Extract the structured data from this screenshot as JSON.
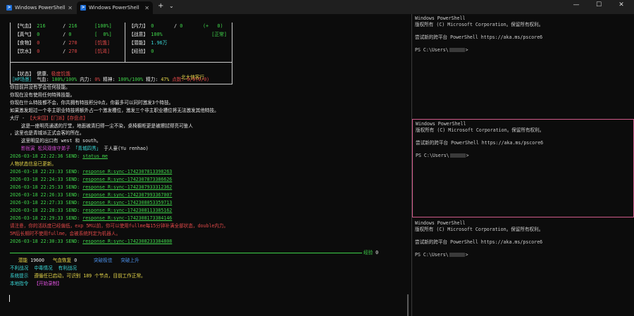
{
  "tabs": [
    {
      "title": "Windows PowerShell",
      "active": false
    },
    {
      "title": "Windows PowerShell",
      "active": true
    }
  ],
  "window_controls": {
    "new_tab": "+",
    "dropdown": "⌄",
    "minimize": "—",
    "maximize": "☐",
    "close": "✕"
  },
  "stats": {
    "qixue": {
      "label": "【气血】",
      "cur": "216",
      "sep": "/",
      "max": "216",
      "pct": "[100%]"
    },
    "jingqi": {
      "label": "【真气】",
      "cur": "0",
      "sep": "/",
      "max": "0",
      "pct": "[  0%]"
    },
    "shiwu": {
      "label": "【食物】",
      "cur": "0",
      "sep": "/",
      "max": "270",
      "status": "[饥饿]"
    },
    "yinshui": {
      "label": "【饮水】",
      "cur": "0",
      "sep": "/",
      "max": "270",
      "status": "[饥渴]"
    },
    "neili": {
      "label": "【内力】",
      "cur": "0",
      "sep": "/",
      "max": "0",
      "extra": "(+   0)"
    },
    "zhanyi": {
      "label": "【战意】",
      "val": "100%",
      "status": "[正常]"
    },
    "qianneng": {
      "label": "【潜能】",
      "val": "1.96万"
    },
    "jingyan": {
      "label": "【经验】",
      "val": "0"
    },
    "zhuangtai": {
      "label": "【状态】",
      "v1": "健康、",
      "v2": "极度饥饿"
    },
    "box_title": "北大侠客行"
  },
  "hp_line": {
    "prefix": "［HP场景］",
    "qixue_label": "气血:",
    "qixue_val": "100%/100%",
    "neili_label": "内力:",
    "neili_val": "0%",
    "jingshen_label": "精神:",
    "jingshen_val": "100%/100%",
    "jingli_label": "精力:",
    "jingli_val": "47%",
    "point_label": "点数:",
    "point_val": "0/0(0/0)"
  },
  "lines": {
    "l1": "你目前并没有学会任何技能。",
    "l2": "你现在没有使用任何特殊技能。",
    "l3": "你现在什么特技都不会，你共拥有特技积分0点，你最多可以同时激发3个特技。",
    "l4": "如果激发超过一个非主职业特技将额外占一个激发槽位，激发三个非主职业槽位将无法激发其他特技。",
    "place_a": "大厅 - ",
    "place_b": "【大宋国】【门派】【存盘点】",
    "desc1": "    这是一座明亮通透的厅堂，地面被清扫得一尘不染，桌椅橱柜更是被擦拭得亮可鉴人",
    "desc2": "，这里也是青城派正式会客的所在。",
    "exits": "    这里明显的出口有 west 和 south。",
    "npc_a": "    影衙寅 松风观值守弟子",
    "npc_b": "「青城四秀」",
    "npc_c": "于人豪(Yu renhao)",
    "log1_ts": "2026-03-18 22:22:36 SEND:",
    "log1_cmd": "status_me",
    "updated": "人物状态信息已更新。",
    "r1_ts": "2026-03-18 22:23:33 SEND:",
    "r1_cmd": "response R:sync-1742307813398263",
    "r2_ts": "2026-03-18 22:24:33 SEND:",
    "r2_cmd": "response R:sync-1742307873386626",
    "r3_ts": "2026-03-18 22:25:33 SEND:",
    "r3_cmd": "response R:sync-1742307933312362",
    "r4_ts": "2026-03-18 22:26:33 SEND:",
    "r4_cmd": "response R:sync-1742307993367007",
    "r5_ts": "2026-03-18 22:27:33 SEND:",
    "r5_cmd": "response R:sync-1742308053359713",
    "r6_ts": "2026-03-18 22:28:33 SEND:",
    "r6_cmd": "response R:sync-1742308113385162",
    "r7_ts": "2026-03-18 22:29:33 SEND:",
    "r7_cmd": "response R:sync-1742308173384146",
    "warn1": "请注意，你的活跃度已经偏低，exp 5M以前，你可以使用fullme每15分钟补满全部状态，double内力。",
    "warn2": "5M后长期时不使用fullme，会被系统判定为机器人。",
    "r8_ts": "2026-03-18 22:30:33 SEND:",
    "r8_cmd": "response R:sync-1742308233384808",
    "bar_label": "经验",
    "bar_val": "0",
    "qn_label": "潜能",
    "qn_val": "19600",
    "qx_label": "气血恢复",
    "qx_val": "0",
    "tupo1": "突破极佳",
    "tupo2": "突破上升",
    "f1": "不利战况",
    "f2": "中毒情况",
    "f3": "有利战况",
    "sys_label": "系统提示",
    "sys_msg": "遵循任已启动，可识别 189 个节点，目前工作正常。",
    "local_label": "本地指令",
    "local_btn": "【开始录制】"
  },
  "right_panes": [
    {
      "l1": "Windows PowerShell",
      "l2": "版权所有 (C) Microsoft Corporation。保留所有权利。",
      "l3": "尝试新的跨平台 PowerShell https://aka.ms/pscore6",
      "prompt_a": "PS C:\\Users\\",
      "prompt_b": ">"
    },
    {
      "l1": "Windows PowerShell",
      "l2": "版权所有 (C) Microsoft Corporation。保留所有权利。",
      "l3": "尝试新的跨平台 PowerShell https://aka.ms/pscore6",
      "prompt_a": "PS C:\\Users\\",
      "prompt_b": ">"
    },
    {
      "l1": "Windows PowerShell",
      "l2": "版权所有 (C) Microsoft Corporation。保留所有权利。",
      "l3": "尝试新的跨平台 PowerShell https://aka.ms/pscore6",
      "prompt_a": "PS C:\\Users\\",
      "prompt_b": ">"
    }
  ]
}
